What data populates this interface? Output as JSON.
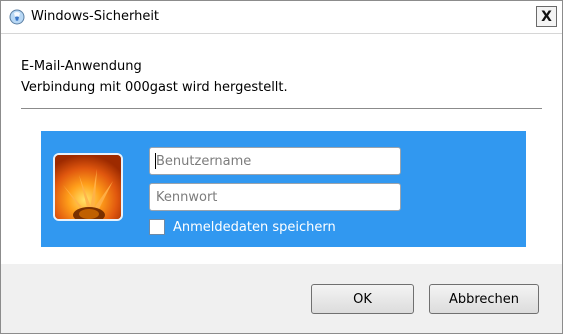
{
  "window": {
    "title": "Windows-Sicherheit",
    "close_label": "X"
  },
  "dialog": {
    "app_name": "E-Mail-Anwendung",
    "message": "Verbindung mit 000gast wird hergestellt."
  },
  "credentials": {
    "username_value": "",
    "username_placeholder": "Benutzername",
    "password_value": "",
    "password_placeholder": "Kennwort",
    "remember_label": "Anmeldedaten speichern",
    "remember_checked": false
  },
  "buttons": {
    "ok_label": "OK",
    "cancel_label": "Abbrechen"
  },
  "icons": {
    "title_icon": "windows-security-icon",
    "avatar": "flower-avatar-icon"
  },
  "colors": {
    "tile_blue": "#3198f0"
  }
}
